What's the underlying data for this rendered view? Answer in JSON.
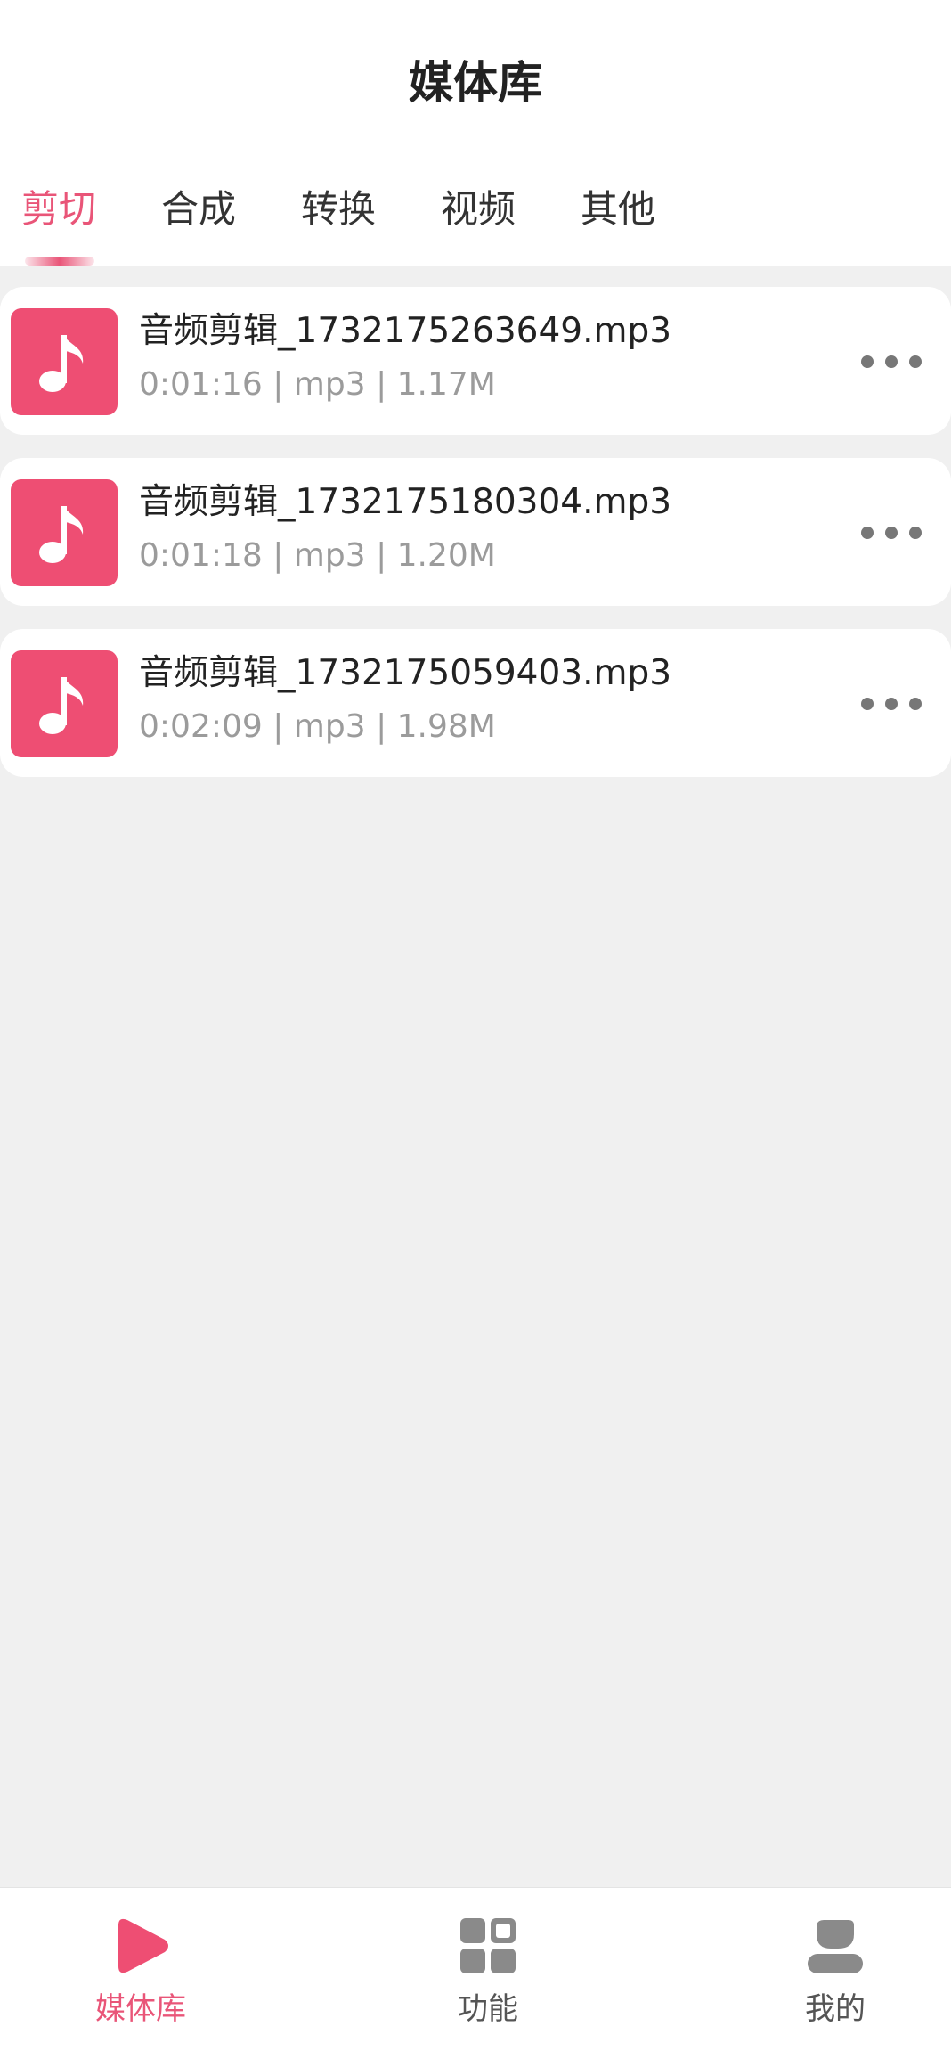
{
  "header": {
    "title": "媒体库"
  },
  "tabs": [
    {
      "label": "剪切",
      "active": true
    },
    {
      "label": "合成",
      "active": false
    },
    {
      "label": "转换",
      "active": false
    },
    {
      "label": "视频",
      "active": false
    },
    {
      "label": "其他",
      "active": false
    }
  ],
  "files": [
    {
      "name": "音频剪辑_1732175263649.mp3",
      "meta": "0:01:16 | mp3 | 1.17M",
      "icon": "music-note-icon"
    },
    {
      "name": "音频剪辑_1732175180304.mp3",
      "meta": "0:01:18 | mp3 | 1.20M",
      "icon": "music-note-icon"
    },
    {
      "name": "音频剪辑_1732175059403.mp3",
      "meta": "0:02:09 | mp3 | 1.98M",
      "icon": "music-note-icon"
    }
  ],
  "bottom_nav": [
    {
      "label": "媒体库",
      "icon": "play-icon",
      "active": true
    },
    {
      "label": "功能",
      "icon": "grid-icon",
      "active": false
    },
    {
      "label": "我的",
      "icon": "user-icon",
      "active": false
    }
  ],
  "colors": {
    "accent": "#e95578",
    "thumb": "#ee4e73",
    "background": "#f0f0f0",
    "meta_text": "#9b9b9b",
    "inactive_icon": "#8a8a8a"
  }
}
